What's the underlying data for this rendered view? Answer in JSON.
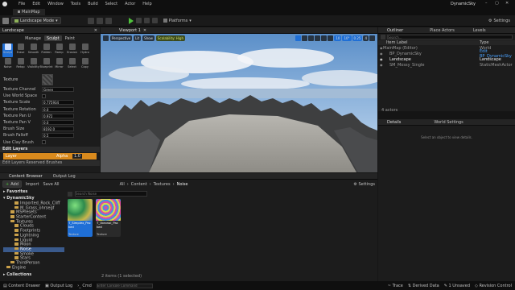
{
  "app": {
    "project_name": "DynamicSky",
    "map_tab": "MainMap"
  },
  "menu": [
    "File",
    "Edit",
    "Window",
    "Tools",
    "Build",
    "Select",
    "Actor",
    "Help"
  ],
  "toolbar": {
    "mode": "Landscape Mode",
    "platforms": "Platforms",
    "settings": "Settings"
  },
  "landscape": {
    "tab": "Landscape",
    "modes": [
      "Manage",
      "Sculpt",
      "Paint"
    ],
    "active_mode": "Sculpt",
    "tools_row1": [
      "Sculpt",
      "Erase",
      "Smooth",
      "Flatten",
      "Ramp",
      "Erosion",
      "Hydro"
    ],
    "tools_row2": [
      "Noise",
      "Retop",
      "Visibility",
      "Blueprint",
      "Mirror",
      "Select",
      "Copy"
    ],
    "texture_label": "Texture",
    "props": [
      {
        "label": "Texture Channel",
        "value": "Green"
      },
      {
        "label": "Use World Space",
        "value": ""
      },
      {
        "label": "Texture Scale",
        "value": "0.775934"
      },
      {
        "label": "Texture Rotation",
        "value": "0.0"
      },
      {
        "label": "Texture Pan U",
        "value": "0.972"
      },
      {
        "label": "Texture Pan V",
        "value": "0.0"
      },
      {
        "label": "Brush Size",
        "value": "8192.0"
      },
      {
        "label": "Brush Falloff",
        "value": "0.5"
      },
      {
        "label": "Use Clay Brush",
        "value": ""
      }
    ],
    "edit_layers": "Edit Layers",
    "layer_name": "Layer",
    "layer_alpha": "Alpha",
    "layer_alpha_value": "1.0",
    "reserved_brush": "Edit Layers Reserved Brushes"
  },
  "viewport": {
    "tab": "Viewport 1",
    "perspective": "Perspective",
    "lit": "Lit",
    "show": "Show",
    "scalability": "Scalability: High",
    "grid_snap": "10",
    "rot_snap": "10°",
    "scale_snap": "0.25",
    "camera_speed": "4"
  },
  "outliner": {
    "tab": "Outliner",
    "place_actors": "Place Actors",
    "levels": "Levels",
    "search_placeholder": "Search...",
    "col_label": "Item Label",
    "col_type": "Type",
    "rows": [
      {
        "label": "MainMap (Editor)",
        "type": "World"
      },
      {
        "label": "BP_DynamicSky",
        "type": "Edit BP_DynamicSky"
      },
      {
        "label": "Landscape",
        "type": "Landscape"
      },
      {
        "label": "SM_Mossy_Single",
        "type": "StaticMeshActor"
      }
    ],
    "count": "4 actors"
  },
  "details": {
    "tab": "Details",
    "world_settings": "World Settings",
    "empty_msg": "Select an object to view details."
  },
  "content_browser": {
    "tab": "Content Browser",
    "output_tab": "Output Log",
    "add": "Add",
    "import": "Import",
    "save_all": "Save All",
    "path": [
      "All",
      "Content",
      "Textures",
      "Noise"
    ],
    "settings": "Settings",
    "favorites": "Favorites",
    "root": "DynamicSky",
    "tree": [
      {
        "name": "Imported_Rock_Cliff",
        "depth": 2
      },
      {
        "name": "M_Grass_ohrsegf",
        "depth": 2
      },
      {
        "name": "MSPresets",
        "depth": 1
      },
      {
        "name": "StarterContent",
        "depth": 1
      },
      {
        "name": "Textures",
        "depth": 1
      },
      {
        "name": "Clouds",
        "depth": 2
      },
      {
        "name": "Footprints",
        "depth": 2
      },
      {
        "name": "Lightning",
        "depth": 2
      },
      {
        "name": "Liquid",
        "depth": 2
      },
      {
        "name": "Moon",
        "depth": 2
      },
      {
        "name": "Noise",
        "depth": 2,
        "selected": true
      },
      {
        "name": "Smoke",
        "depth": 2
      },
      {
        "name": "Stars",
        "depth": 2
      },
      {
        "name": "ThirdPerson",
        "depth": 1
      },
      {
        "name": "Engine",
        "depth": 0
      }
    ],
    "search_placeholder": "Search Noise",
    "assets": [
      {
        "name": "T_Simplex_Packed",
        "type": "Texture",
        "selected": true
      },
      {
        "name": "T_Voronoi_Packed",
        "type": "Texture",
        "selected": false
      }
    ],
    "status": "2 items (1 selected)",
    "collections": "Collections"
  },
  "statusbar": {
    "content_drawer": "Content Drawer",
    "output_log": "Output Log",
    "cmd": "Cmd",
    "cmd_placeholder": "Enter Console Command",
    "trace": "Trace",
    "derived_data": "Derived Data",
    "unsaved": "1 Unsaved",
    "revision_control": "Revision Control"
  },
  "colors": {
    "accent": "#1f6fd6",
    "toolbar_bg": "#1a1a1a",
    "panel_bg": "#1c1c1c",
    "folder": "#c9a04a",
    "layer_bar": "#d98a1d"
  },
  "icons": [
    "unreal-logo-icon",
    "save-icon",
    "play-icon",
    "settings-icon",
    "search-icon",
    "folder-icon",
    "close-icon"
  ]
}
